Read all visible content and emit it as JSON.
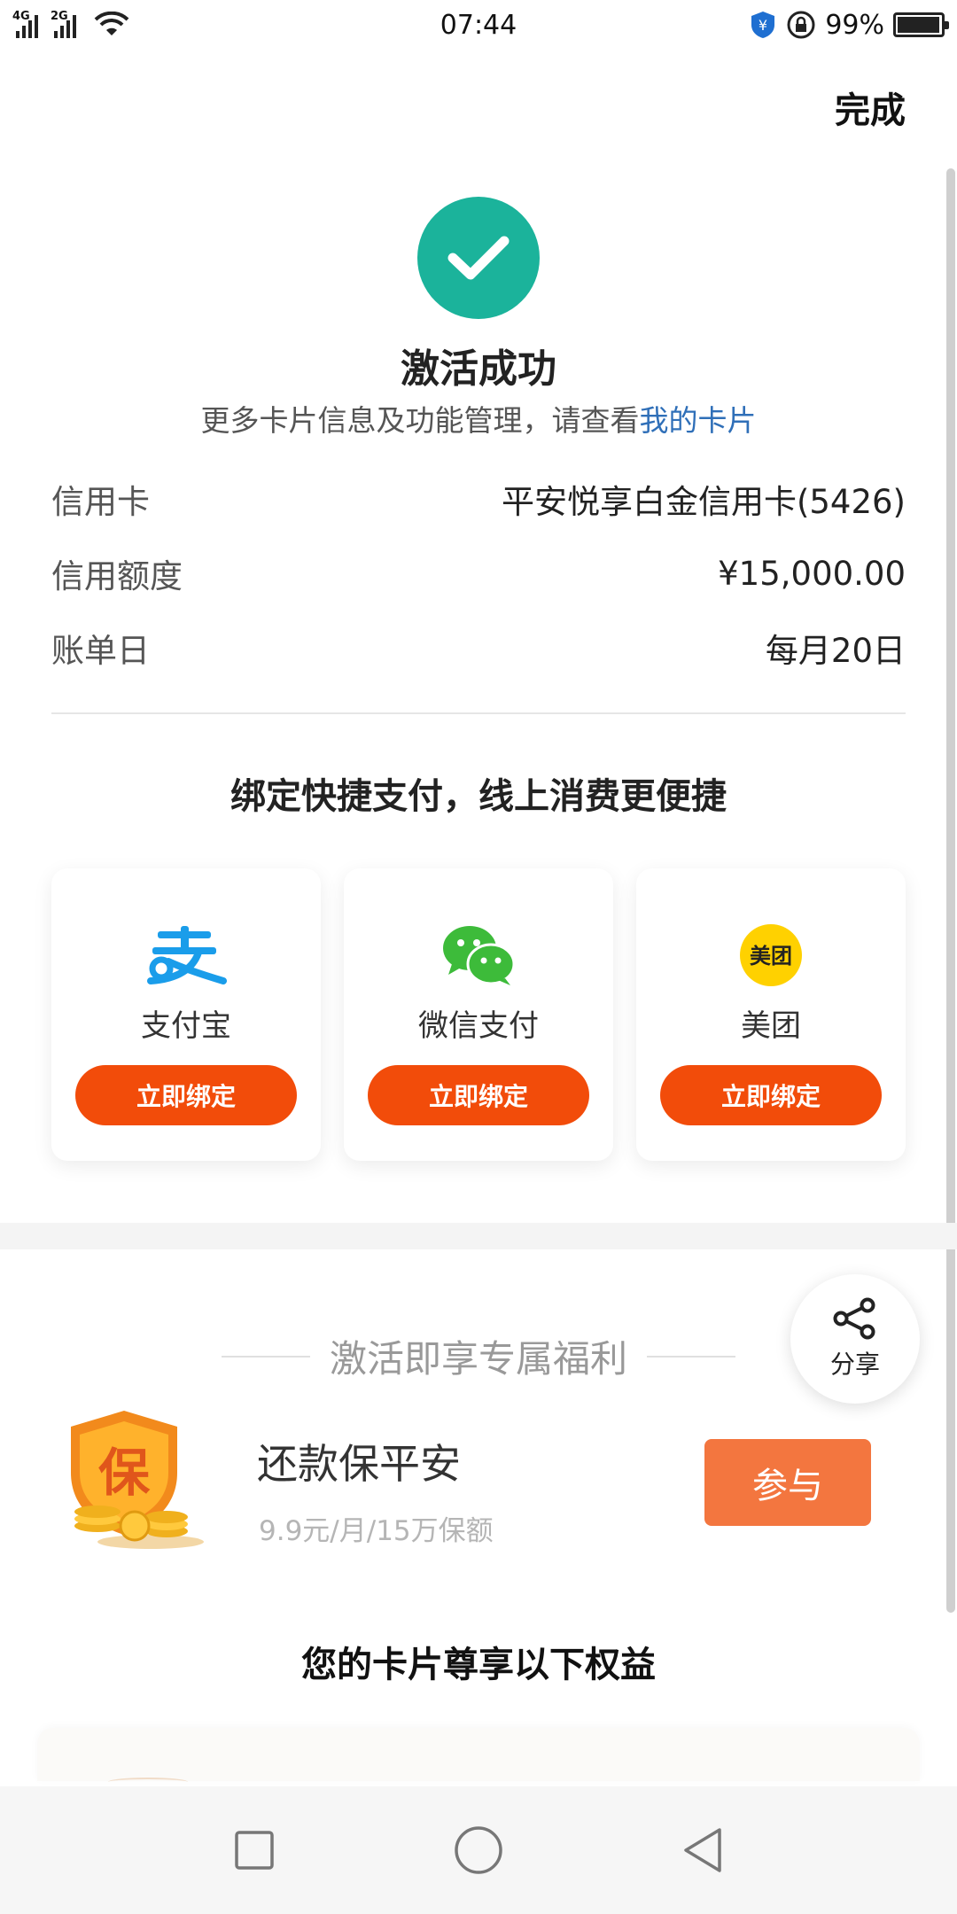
{
  "status_bar": {
    "network1": "4G",
    "network2": "2G",
    "time": "07:44",
    "battery": "99%"
  },
  "header": {
    "done_label": "完成"
  },
  "success": {
    "title": "激活成功",
    "subtitle_prefix": "更多卡片信息及功能管理，请查看",
    "subtitle_link": "我的卡片"
  },
  "card_info": [
    {
      "label": "信用卡",
      "value": "平安悦享白金信用卡(5426)"
    },
    {
      "label": "信用额度",
      "value": "¥15,000.00"
    },
    {
      "label": "账单日",
      "value": "每月20日"
    }
  ],
  "bind_section": {
    "title": "绑定快捷支付，线上消费更便捷",
    "options": [
      {
        "name": "支付宝",
        "button": "立即绑定",
        "icon": "alipay-icon"
      },
      {
        "name": "微信支付",
        "button": "立即绑定",
        "icon": "wechat-pay-icon"
      },
      {
        "name": "美团",
        "button": "立即绑定",
        "icon": "meituan-icon",
        "logo_text": "美团"
      }
    ]
  },
  "benefits": {
    "heading": "激活即享专属福利",
    "share_label": "分享",
    "promo": {
      "icon_text": "保",
      "title": "还款保平安",
      "subtitle": "9.9元/月/15万保额",
      "button": "参与"
    },
    "perks_title": "您的卡片尊享以下权益"
  },
  "colors": {
    "success_green": "#1bb39b",
    "bind_orange": "#f24c0a",
    "join_orange": "#f3763f",
    "link_blue": "#2f6fb8",
    "alipay_blue": "#1a9dea",
    "wechat_green": "#3dbb3a",
    "meituan_yellow": "#ffd100"
  }
}
